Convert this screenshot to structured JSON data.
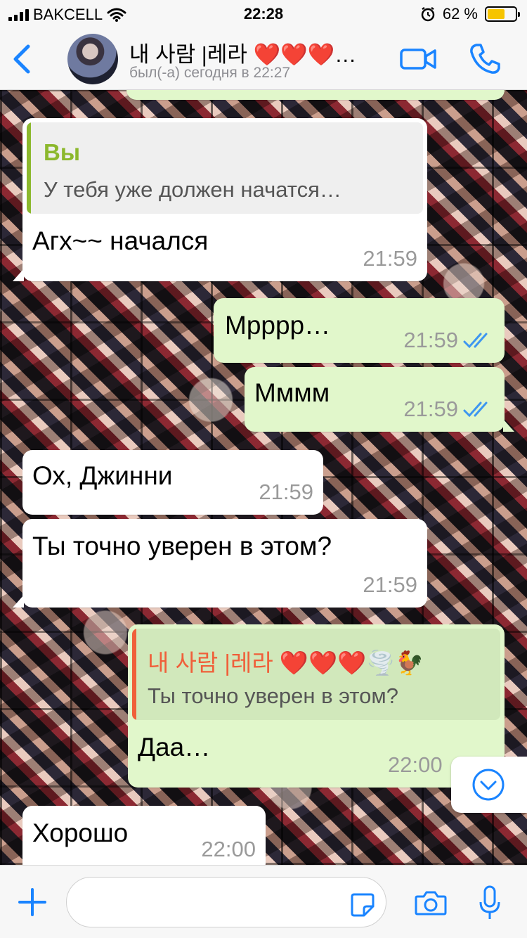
{
  "status_bar": {
    "carrier": "BAKCELL",
    "time": "22:28",
    "battery": "62 %",
    "battery_level": 0.62
  },
  "header": {
    "contact_name": "내 사람 |레라 ❤️❤️❤️…",
    "contact_status": "был(-а) сегодня в 22:27"
  },
  "messages": [
    {
      "direction": "in",
      "quote_author": "Вы",
      "quote_text": "У тебя уже должен начатся…",
      "text": "Агх~~ начался",
      "time": "21:59"
    },
    {
      "direction": "out",
      "text": "Мрррр…",
      "time": "21:59",
      "read": true
    },
    {
      "direction": "out",
      "text": "Мммм",
      "time": "21:59",
      "read": true
    },
    {
      "direction": "in",
      "text": "Ох, Джинни",
      "time": "21:59"
    },
    {
      "direction": "in",
      "text": "Ты точно уверен в этом?",
      "time": "21:59"
    },
    {
      "direction": "out",
      "quote_author": "내 사람 |레라 ❤️❤️❤️🌪️🐓",
      "quote_text": "Ты точно уверен в этом?",
      "text": "Даа…",
      "time": "22:00"
    },
    {
      "direction": "in",
      "text": "Хорошо",
      "time": "22:00"
    }
  ],
  "colors": {
    "accent": "#1a84ff",
    "outgoing_bubble": "#e1f7cb",
    "incoming_bubble": "#ffffff",
    "quote_you": "#8cb82d",
    "quote_contact": "#f05f3a",
    "read_ticks": "#3d96f0"
  },
  "icons": {
    "back": "chevron-left-icon",
    "video": "video-camera-icon",
    "call": "phone-icon",
    "plus": "plus-icon",
    "sticker": "sticker-icon",
    "camera": "camera-icon",
    "mic": "microphone-icon",
    "scroll": "chevron-down-icon"
  }
}
